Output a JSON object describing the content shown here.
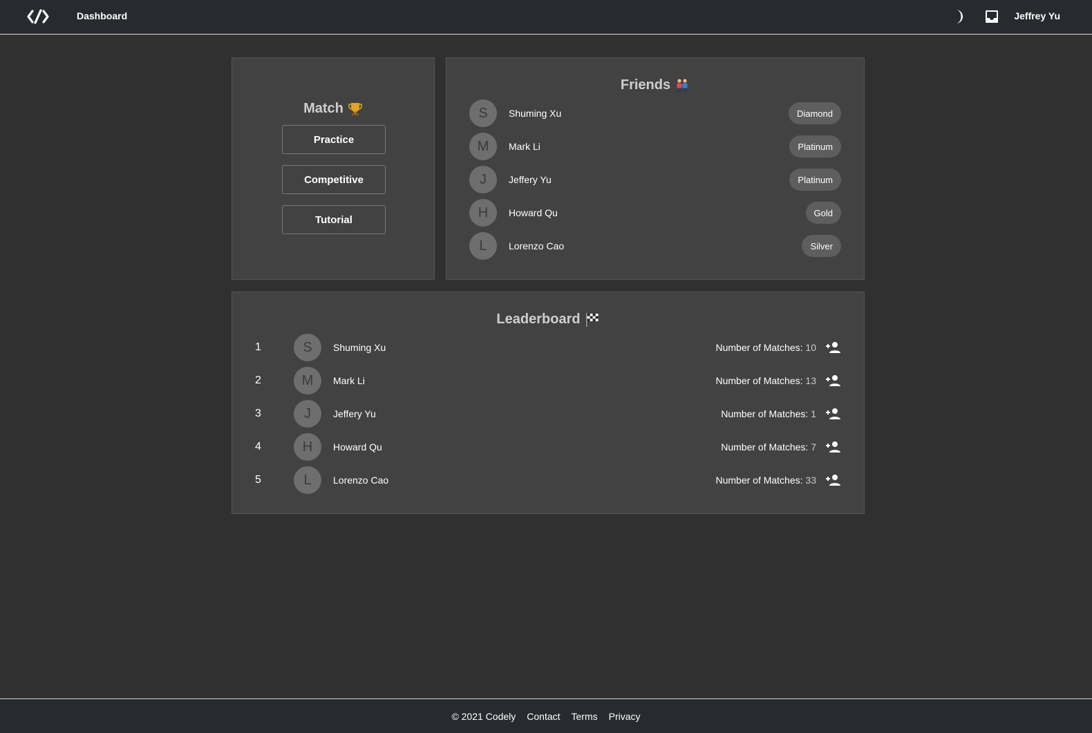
{
  "header": {
    "logo_icon": "code-bracket-logo",
    "nav_label": "Dashboard",
    "theme_icon": "moon-icon",
    "inbox_icon": "inbox-icon",
    "username": "Jeffrey Yu"
  },
  "match": {
    "title": "Match",
    "title_icon": "trophy-icon",
    "buttons": [
      "Practice",
      "Competitive",
      "Tutorial"
    ]
  },
  "friends": {
    "title": "Friends",
    "title_icon": "two-people-icon",
    "items": [
      {
        "initial": "S",
        "name": "Shuming Xu",
        "rank": "Diamond"
      },
      {
        "initial": "M",
        "name": "Mark Li",
        "rank": "Platinum"
      },
      {
        "initial": "J",
        "name": "Jeffery Yu",
        "rank": "Platinum"
      },
      {
        "initial": "H",
        "name": "Howard Qu",
        "rank": "Gold"
      },
      {
        "initial": "L",
        "name": "Lorenzo Cao",
        "rank": "Silver"
      }
    ]
  },
  "leaderboard": {
    "title": "Leaderboard",
    "title_icon": "checkered-flag-icon",
    "matches_label": "Number of Matches:",
    "add_icon": "person-add-icon",
    "items": [
      {
        "position": "1",
        "initial": "S",
        "name": "Shuming Xu",
        "matches": "10"
      },
      {
        "position": "2",
        "initial": "M",
        "name": "Mark Li",
        "matches": "13"
      },
      {
        "position": "3",
        "initial": "J",
        "name": "Jeffery Yu",
        "matches": "1"
      },
      {
        "position": "4",
        "initial": "H",
        "name": "Howard Qu",
        "matches": "7"
      },
      {
        "position": "5",
        "initial": "L",
        "name": "Lorenzo Cao",
        "matches": "33"
      }
    ]
  },
  "footer": {
    "copyright": "© 2021 Codely",
    "links": [
      "Contact",
      "Terms",
      "Privacy"
    ]
  },
  "colors": {
    "background": "#303030",
    "bar": "#272a2f",
    "card": "#424242",
    "avatar": "#6e6e6e",
    "badge": "#5e5e5e"
  }
}
